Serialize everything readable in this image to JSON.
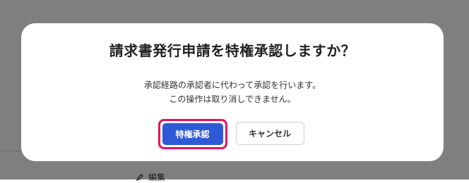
{
  "background": {
    "edit_link_label": "編集"
  },
  "dialog": {
    "title": "請求書発行申請を特権承認しますか？",
    "message_line1": "承認経路の承認者に代わって承認を行います。",
    "message_line2": "この操作は取り消しできません。",
    "confirm_label": "特権承認",
    "cancel_label": "キャンセル"
  },
  "colors": {
    "primary": "#2f5ad7",
    "focus_ring": "#e6125d",
    "overlay": "rgba(0,0,0,0.5)"
  },
  "icons": {
    "edit": "pencil-icon"
  }
}
